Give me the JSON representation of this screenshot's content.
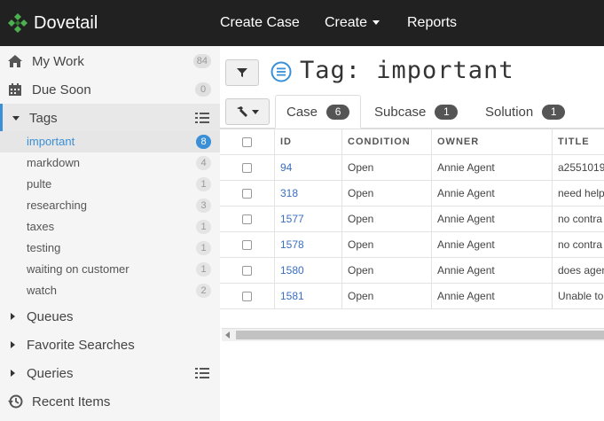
{
  "brand": {
    "name": "Dovetail"
  },
  "nav": {
    "create_case": "Create Case",
    "create": "Create",
    "reports": "Reports"
  },
  "sidebar": {
    "my_work": {
      "label": "My Work",
      "count": "84"
    },
    "due_soon": {
      "label": "Due Soon",
      "count": "0"
    },
    "tags": {
      "label": "Tags"
    },
    "tag_items": [
      {
        "label": "important",
        "count": "8"
      },
      {
        "label": "markdown",
        "count": "4"
      },
      {
        "label": "pulte",
        "count": "1"
      },
      {
        "label": "researching",
        "count": "3"
      },
      {
        "label": "taxes",
        "count": "1"
      },
      {
        "label": "testing",
        "count": "1"
      },
      {
        "label": "waiting on customer",
        "count": "1"
      },
      {
        "label": "watch",
        "count": "2"
      }
    ],
    "queues": {
      "label": "Queues"
    },
    "favorite_searches": {
      "label": "Favorite Searches"
    },
    "queries": {
      "label": "Queries"
    },
    "recent_items": {
      "label": "Recent Items"
    }
  },
  "page": {
    "title": "Tag: important"
  },
  "tabs": [
    {
      "label": "Case",
      "count": "6"
    },
    {
      "label": "Subcase",
      "count": "1"
    },
    {
      "label": "Solution",
      "count": "1"
    }
  ],
  "table": {
    "headers": {
      "id": "ID",
      "condition": "CONDITION",
      "owner": "OWNER",
      "title": "TITLE"
    },
    "rows": [
      {
        "id": "94",
        "condition": "Open",
        "owner": "Annie Agent",
        "title": "a2551019"
      },
      {
        "id": "318",
        "condition": "Open",
        "owner": "Annie Agent",
        "title": "need help"
      },
      {
        "id": "1577",
        "condition": "Open",
        "owner": "Annie Agent",
        "title": "no contra"
      },
      {
        "id": "1578",
        "condition": "Open",
        "owner": "Annie Agent",
        "title": "no contra"
      },
      {
        "id": "1580",
        "condition": "Open",
        "owner": "Annie Agent",
        "title": "does agen"
      },
      {
        "id": "1581",
        "condition": "Open",
        "owner": "Annie Agent",
        "title": "Unable to"
      }
    ]
  },
  "colors": {
    "topbar": "#212121",
    "accent": "#3a8fd6",
    "logo": "#4caf50"
  },
  "icons": [
    "dovetail-logo-icon",
    "home-icon",
    "calendar-icon",
    "list-icon",
    "history-icon",
    "filter-icon",
    "tag-list-icon",
    "hammer-icon"
  ]
}
